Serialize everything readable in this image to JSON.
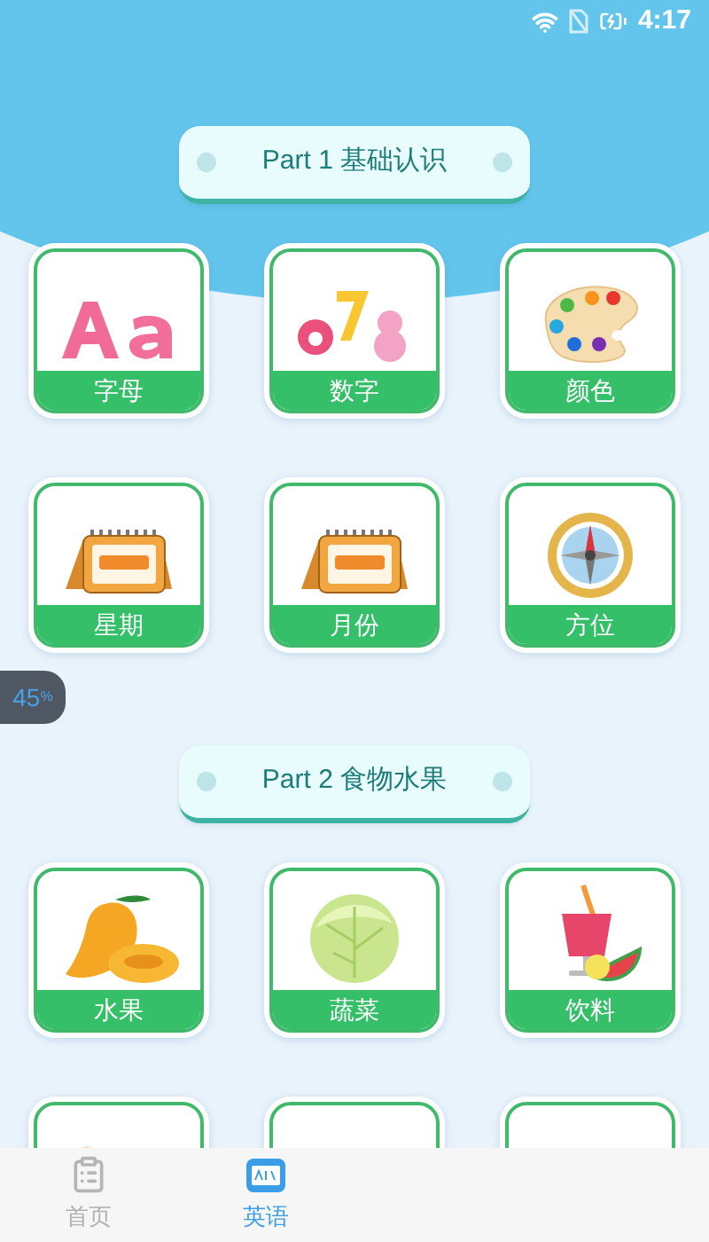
{
  "status_bar": {
    "time": "4:17"
  },
  "float_badge": {
    "text": "45",
    "unit": "%"
  },
  "sections": [
    {
      "title": "Part 1 基础认识",
      "items": [
        {
          "label": "字母"
        },
        {
          "label": "数字"
        },
        {
          "label": "颜色"
        },
        {
          "label": "星期"
        },
        {
          "label": "月份"
        },
        {
          "label": "方位"
        }
      ]
    },
    {
      "title": "Part 2 食物水果",
      "items": [
        {
          "label": "水果"
        },
        {
          "label": "蔬菜"
        },
        {
          "label": "饮料"
        },
        {
          "kind": "cut"
        },
        {
          "kind": "cut"
        },
        {
          "kind": "cut"
        }
      ]
    }
  ],
  "tabs": [
    {
      "label": "首页",
      "selected": false,
      "kind": "home"
    },
    {
      "label": "英语",
      "selected": true,
      "kind": "english"
    }
  ]
}
